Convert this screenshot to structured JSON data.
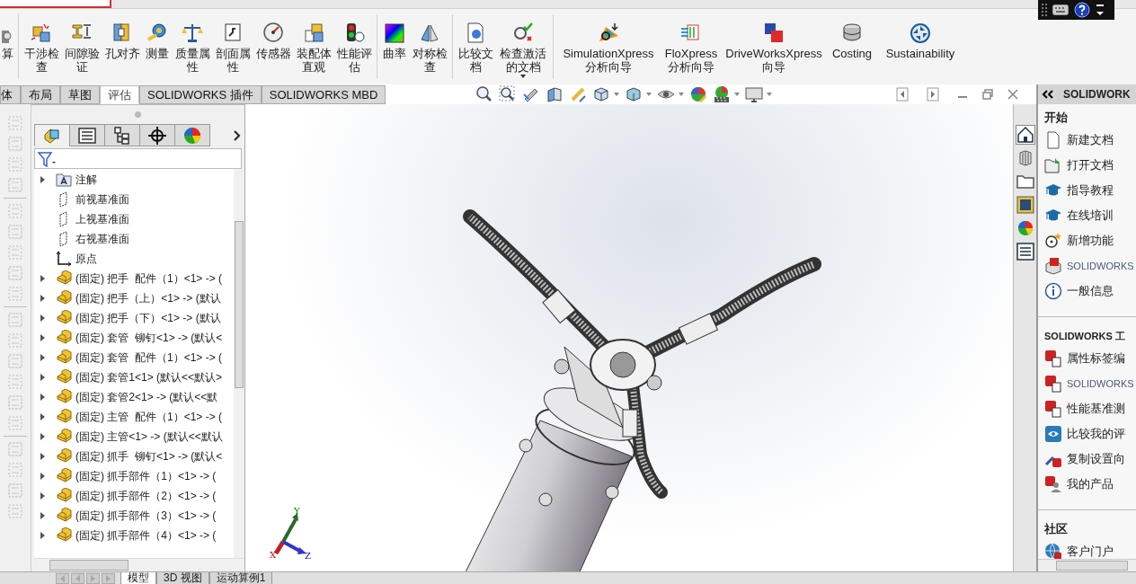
{
  "ribbon": {
    "groups": [
      {
        "items": [
          {
            "label": "算",
            "dropdown": false
          }
        ]
      },
      {
        "items": [
          {
            "label": "干涉检查",
            "dropdown": false
          },
          {
            "label": "间隙验证",
            "dropdown": false
          },
          {
            "label": "孔对齐",
            "dropdown": false
          },
          {
            "label": "测量",
            "dropdown": false
          },
          {
            "label": "质量属性",
            "dropdown": false
          },
          {
            "label": "剖面属性",
            "dropdown": false
          },
          {
            "label": "传感器",
            "dropdown": false
          },
          {
            "label": "装配体直观",
            "dropdown": false
          },
          {
            "label": "性能评估",
            "dropdown": false
          }
        ]
      },
      {
        "items": [
          {
            "label": "曲率",
            "dropdown": false
          },
          {
            "label": "对称检查",
            "dropdown": false
          }
        ]
      },
      {
        "items": [
          {
            "label": "比较文档",
            "dropdown": false
          },
          {
            "label": "检查激活的文档",
            "dropdown": true
          }
        ]
      },
      {
        "items": [
          {
            "label": "SimulationXpress 分析向导",
            "dropdown": false
          },
          {
            "label": "FloXpress 分析向导",
            "dropdown": false
          },
          {
            "label": "DriveWorksXpress 向导",
            "dropdown": false
          },
          {
            "label": "Costing",
            "dropdown": false
          },
          {
            "label": "Sustainability",
            "dropdown": false
          }
        ]
      }
    ]
  },
  "command_tabs": [
    {
      "label": "体",
      "selected": false
    },
    {
      "label": "布局",
      "selected": false
    },
    {
      "label": "草图",
      "selected": false
    },
    {
      "label": "评估",
      "selected": true
    },
    {
      "label": "SOLIDWORKS 插件",
      "selected": false
    },
    {
      "label": "SOLIDWORKS MBD",
      "selected": false
    }
  ],
  "panel_tabs": [
    {
      "selected": true
    },
    {
      "selected": false
    },
    {
      "selected": false
    },
    {
      "selected": false
    },
    {
      "selected": false
    }
  ],
  "tree": [
    {
      "label": "注解",
      "kind": "annotation",
      "expandable": true
    },
    {
      "label": "前视基准面",
      "kind": "plane",
      "expandable": false
    },
    {
      "label": "上视基准面",
      "kind": "plane",
      "expandable": false
    },
    {
      "label": "右视基准面",
      "kind": "plane",
      "expandable": false
    },
    {
      "label": "原点",
      "kind": "origin",
      "expandable": false
    },
    {
      "label": "(固定) 把手  配件（1）<1> -> (",
      "kind": "part",
      "expandable": true
    },
    {
      "label": "(固定) 把手（上）<1> -> (默认",
      "kind": "part",
      "expandable": true
    },
    {
      "label": "(固定) 把手（下）<1> -> (默认",
      "kind": "part",
      "expandable": true
    },
    {
      "label": "(固定) 套管  铆钉<1> -> (默认<",
      "kind": "part",
      "expandable": true
    },
    {
      "label": "(固定) 套管  配件（1）<1> -> (",
      "kind": "part",
      "expandable": true
    },
    {
      "label": "(固定) 套管1<1> (默认<<默认>",
      "kind": "part",
      "expandable": true
    },
    {
      "label": "(固定) 套管2<1> -> (默认<<默",
      "kind": "part",
      "expandable": true
    },
    {
      "label": "(固定) 主管  配件（1）<1> -> (",
      "kind": "part",
      "expandable": true
    },
    {
      "label": "(固定) 主管<1> -> (默认<<默认",
      "kind": "part",
      "expandable": true
    },
    {
      "label": "(固定) 抓手  铆钉<1> -> (默认<",
      "kind": "part",
      "expandable": true
    },
    {
      "label": "(固定) 抓手部件（1）<1> -> (",
      "kind": "part",
      "expandable": true
    },
    {
      "label": "(固定) 抓手部件（2）<1> -> (",
      "kind": "part",
      "expandable": true
    },
    {
      "label": "(固定) 抓手部件（3）<1> -> (",
      "kind": "part",
      "expandable": true
    },
    {
      "label": "(固定) 抓手部件（4）<1> -> (",
      "kind": "part",
      "expandable": true
    }
  ],
  "triad": {
    "x": "X",
    "y": "Y",
    "z": "Z"
  },
  "bottom_tabs": [
    {
      "label": "模型",
      "selected": true
    },
    {
      "label": "3D 视图",
      "selected": false
    },
    {
      "label": "运动算例1",
      "selected": false
    }
  ],
  "task_pane_tabs": [
    {
      "selected": true
    },
    {
      "selected": false
    },
    {
      "selected": false
    },
    {
      "selected": false
    },
    {
      "selected": false
    },
    {
      "selected": false
    }
  ],
  "task_pane": {
    "title": "SOLIDWORK",
    "sections": [
      {
        "heading": "开始",
        "items": [
          {
            "label": "新建文档",
            "muted": false
          },
          {
            "label": "打开文档",
            "muted": false
          },
          {
            "label": "指导教程",
            "muted": false
          },
          {
            "label": "在线培训",
            "muted": false
          },
          {
            "label": "新增功能",
            "muted": false
          },
          {
            "label": "SOLIDWORKS",
            "muted": true
          },
          {
            "label": "一般信息",
            "muted": false
          }
        ]
      },
      {
        "heading": "SOLIDWORKS 工",
        "items": [
          {
            "label": "属性标签编",
            "muted": false
          },
          {
            "label": "SOLIDWORKS",
            "muted": true
          },
          {
            "label": "性能基准测",
            "muted": false
          },
          {
            "label": "比较我的评",
            "muted": false
          },
          {
            "label": "复制设置向",
            "muted": false
          },
          {
            "label": "我的产品",
            "muted": false
          }
        ]
      },
      {
        "heading": "社区",
        "items": [
          {
            "label": "客户门户",
            "muted": false
          }
        ]
      }
    ]
  }
}
